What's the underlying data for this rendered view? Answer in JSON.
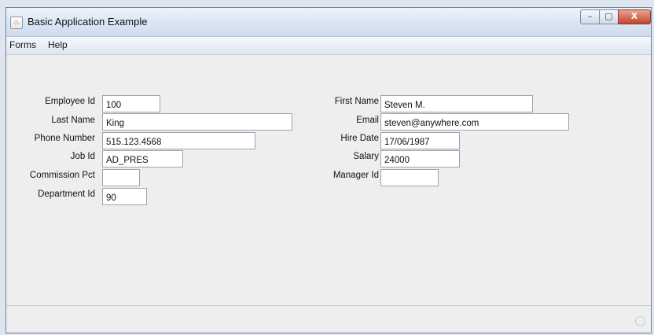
{
  "window": {
    "title": "Basic Application Example",
    "controls": {
      "minimize": "–",
      "maximize": "▢",
      "close": "X"
    }
  },
  "menu": [
    "Forms",
    "Help"
  ],
  "form": {
    "employee_id": {
      "label": "Employee Id",
      "value": "100"
    },
    "last_name": {
      "label": "Last Name",
      "value": "King"
    },
    "phone_number": {
      "label": "Phone Number",
      "value": "515.123.4568"
    },
    "job_id": {
      "label": "Job Id",
      "value": "AD_PRES"
    },
    "commission_pct": {
      "label": "Commission Pct",
      "value": ""
    },
    "department_id": {
      "label": "Department Id",
      "value": "90"
    },
    "first_name": {
      "label": "First Name",
      "value": "Steven M."
    },
    "email": {
      "label": "Email",
      "value": "steven@anywhere.com"
    },
    "hire_date": {
      "label": "Hire Date",
      "value": "17/06/1987"
    },
    "salary": {
      "label": "Salary",
      "value": "24000"
    },
    "manager_id": {
      "label": "Manager Id",
      "value": ""
    }
  }
}
